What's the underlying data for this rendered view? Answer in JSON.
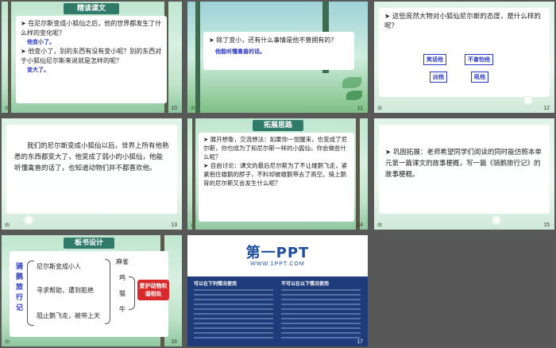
{
  "slides": {
    "s10": {
      "heading": "精读课文",
      "bullet1": "在尼尔斯变成小狐仙之后，他的世界都发生了什么样的变化呢？",
      "answer1": "他变小了。",
      "bullet2": "他变小了，别的东西有没有变小呢？别的东西对于小狐仙尼尔斯来说就是怎样的呢？",
      "answer2": "变大了。",
      "number": "10",
      "mark": "由"
    },
    "s11": {
      "bullet": "除了变小，还有什么事情是他不曾拥有的？",
      "answer": "他能听懂禽兽的话。",
      "number": "11",
      "mark": "由"
    },
    "s12": {
      "bullet": "这些庞然大物对小狐仙尼尔斯的态度，是什么样的呢？",
      "tags": [
        "笑话他",
        "不害怕他",
        "凶他",
        "吼他"
      ],
      "number": "12",
      "mark": "由"
    },
    "s13": {
      "text": "我们的尼尔斯变成小狐仙以后，世界上所有他熟悉的东西都变大了，他变成了弱小的小狐仙，他能听懂禽兽的话了，也知道动物们并不都喜欢他。",
      "number": "13",
      "mark": "由"
    },
    "s14": {
      "heading": "拓展思路",
      "bullet1": "展开想象，交流想法：如果你一觉醒来，也变成了尼尔斯，你也成为了和尼尔斯一样的小狐仙，你会做些什么呢？",
      "bullet2": "自由讨论：课文的最后尼尔斯为了不让雄鹅飞走，紧紧抱住雄鹅的脖子，不料却被雄鹅带去了高空。骑上鹅背的尼尔斯又会发生什么呢？",
      "number": "14",
      "mark": "由"
    },
    "s15": {
      "bullet": "巩固拓展：老师希望同学们阅读的同时能仿照本单元第一篇课文的故事梗概，写一篇《骑鹅旅行记》的故事梗概。",
      "number": "15",
      "mark": "由"
    },
    "s16": {
      "heading": "板书设计",
      "title_vertical": "骑鹅旅行记",
      "rows": [
        "尼尔斯变成小人",
        "寻求帮助，遭到拒绝",
        "阻止鹅飞走，被带上天"
      ],
      "animals": [
        "麻雀",
        "鸡",
        "猫",
        "牛"
      ],
      "badge": "爱护动物和谐相处",
      "number": "16",
      "mark": "由"
    },
    "s17": {
      "logo": "第一PPT",
      "url": "WWW.1PPT.COM",
      "col1_title": "可以在下列情况使用",
      "col2_title": "不可以在以下情况使用",
      "number": "17"
    }
  }
}
